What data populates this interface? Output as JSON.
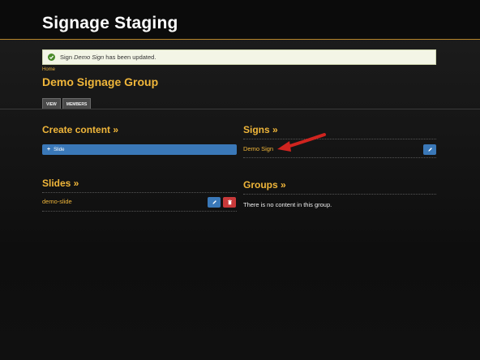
{
  "header": {
    "title": "Signage Staging"
  },
  "status": {
    "prefix": "Sign ",
    "name": "Demo Sign",
    "suffix": " has been updated."
  },
  "breadcrumb": "Home",
  "page_title": "Demo Signage Group",
  "tabs": [
    {
      "label": "VIEW"
    },
    {
      "label": "MEMBERS"
    }
  ],
  "create_content": {
    "title": "Create content »",
    "button_label": "Slide"
  },
  "slides": {
    "title": "Slides »",
    "items": [
      {
        "label": "demo-slide"
      }
    ]
  },
  "signs": {
    "title": "Signs »",
    "items": [
      {
        "label": "Demo Sign"
      }
    ]
  },
  "groups": {
    "title": "Groups »",
    "empty": "There is no content in this group."
  },
  "colors": {
    "accent": "#f0b63a",
    "blue": "#3a78b8",
    "red": "#c8393a",
    "annotation": "#d0241f"
  }
}
